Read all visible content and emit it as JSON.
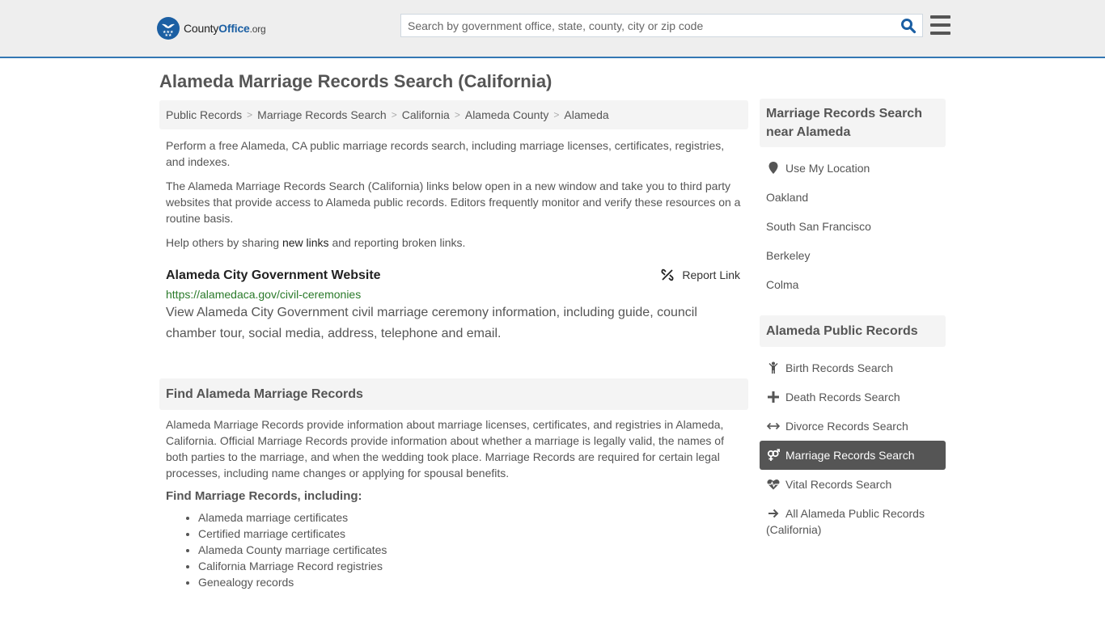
{
  "header": {
    "logo": {
      "name_part1": "County",
      "name_part2": "Office",
      "tld": ".org"
    },
    "search": {
      "placeholder": "Search by government office, state, county, city or zip code",
      "value": ""
    },
    "colors": {
      "brand": "#1b5fa3",
      "accent_border": "#3377b3"
    }
  },
  "page": {
    "title": "Alameda Marriage Records Search (California)"
  },
  "breadcrumb": [
    {
      "label": "Public Records"
    },
    {
      "label": "Marriage Records Search"
    },
    {
      "label": "California"
    },
    {
      "label": "Alameda County"
    },
    {
      "label": "Alameda"
    }
  ],
  "intro": {
    "p1": "Perform a free Alameda, CA public marriage records search, including marriage licenses, certificates, registries, and indexes.",
    "p2": "The Alameda Marriage Records Search (California) links below open in a new window and take you to third party websites that provide access to Alameda public records. Editors frequently monitor and verify these resources on a routine basis.",
    "p3_before": "Help others by sharing ",
    "p3_link": "new links",
    "p3_after": " and reporting broken links."
  },
  "resource": {
    "title": "Alameda City Government Website",
    "report_label": "Report Link",
    "url": "https://alamedaca.gov/civil-ceremonies",
    "description": "View Alameda City Government civil marriage ceremony information, including guide, council chamber tour, social media, address, telephone and email."
  },
  "find_section": {
    "heading": "Find Alameda Marriage Records",
    "body": "Alameda Marriage Records provide information about marriage licenses, certificates, and registries in Alameda, California. Official Marriage Records provide information about whether a marriage is legally valid, the names of both parties to the marriage, and when the wedding took place. Marriage Records are required for certain legal processes, including name changes or applying for spousal benefits.",
    "subheading": "Find Marriage Records, including:",
    "items": [
      "Alameda marriage certificates",
      "Certified marriage certificates",
      "Alameda County marriage certificates",
      "California Marriage Record registries",
      "Genealogy records"
    ]
  },
  "sidebar": {
    "nearby": {
      "heading": "Marriage Records Search near Alameda",
      "use_location": "Use My Location",
      "cities": [
        "Oakland",
        "South San Francisco",
        "Berkeley",
        "Colma"
      ]
    },
    "public_records": {
      "heading": "Alameda Public Records",
      "items": [
        {
          "label": "Birth Records Search",
          "icon": "child-icon",
          "active": false
        },
        {
          "label": "Death Records Search",
          "icon": "plus-icon",
          "active": false
        },
        {
          "label": "Divorce Records Search",
          "icon": "arrows-horizontal-icon",
          "active": false
        },
        {
          "label": "Marriage Records Search",
          "icon": "venus-mars-icon",
          "active": true
        },
        {
          "label": "Vital Records Search",
          "icon": "heartbeat-icon",
          "active": false
        },
        {
          "label": "All Alameda Public Records (California)",
          "icon": "arrow-right-icon",
          "active": false
        }
      ]
    }
  }
}
